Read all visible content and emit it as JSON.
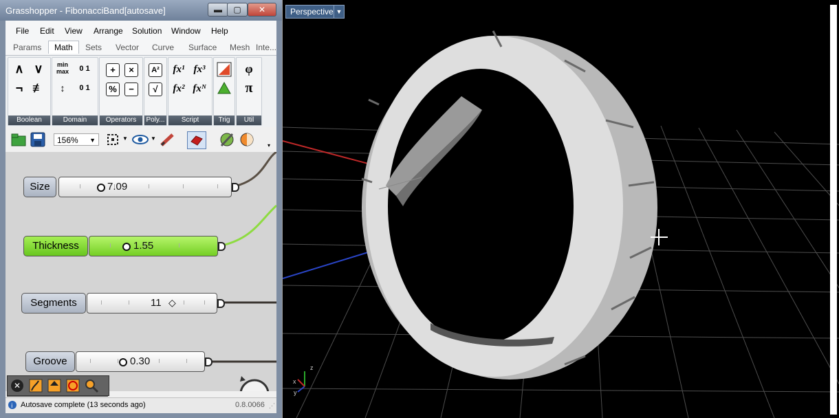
{
  "window": {
    "title": "Grasshopper - FibonacciBand[autosave]",
    "controls": {
      "minimize": "▬",
      "maximize": "▢",
      "close": "✕"
    }
  },
  "menu": [
    "File",
    "Edit",
    "View",
    "Arrange",
    "Solution",
    "Window",
    "Help"
  ],
  "tabs": {
    "items": [
      "Params",
      "Math",
      "Sets",
      "Vector",
      "Curve",
      "Surface",
      "Mesh",
      "Inte..."
    ],
    "active": "Math"
  },
  "ribbon": {
    "groups": [
      "Boolean",
      "Domain",
      "Operators",
      "Poly...",
      "Script",
      "Trig",
      "Util"
    ],
    "boolean_icons": [
      "∧",
      "∨",
      "¬",
      "≢"
    ],
    "domain_icons": [
      "min\nmax",
      "0 1",
      "↕",
      "0 1"
    ],
    "operator_icons": [
      "+",
      "×",
      "%",
      "−"
    ],
    "poly_icons": [
      "A²",
      "√"
    ],
    "script_icons": [
      "fx¹",
      "fx³",
      "fx²",
      "fxᴺ"
    ],
    "util_icons": [
      "φ",
      "π"
    ]
  },
  "toolbar": {
    "zoom": "156%"
  },
  "sliders": [
    {
      "name": "Size",
      "value": "7.09",
      "color": "#b3bcc9"
    },
    {
      "name": "Thickness",
      "value": "1.55",
      "color": "#7fd536"
    },
    {
      "name": "Segments",
      "value": "11",
      "color": "#b3bcc9"
    },
    {
      "name": "Groove",
      "value": "0.30",
      "color": "#b3bcc9"
    }
  ],
  "status": {
    "text": "Autosave complete (13 seconds ago)",
    "version": "0.8.0066"
  },
  "viewport": {
    "label": "Perspective",
    "axes": {
      "z": "z",
      "x": "x",
      "y": "y"
    }
  }
}
